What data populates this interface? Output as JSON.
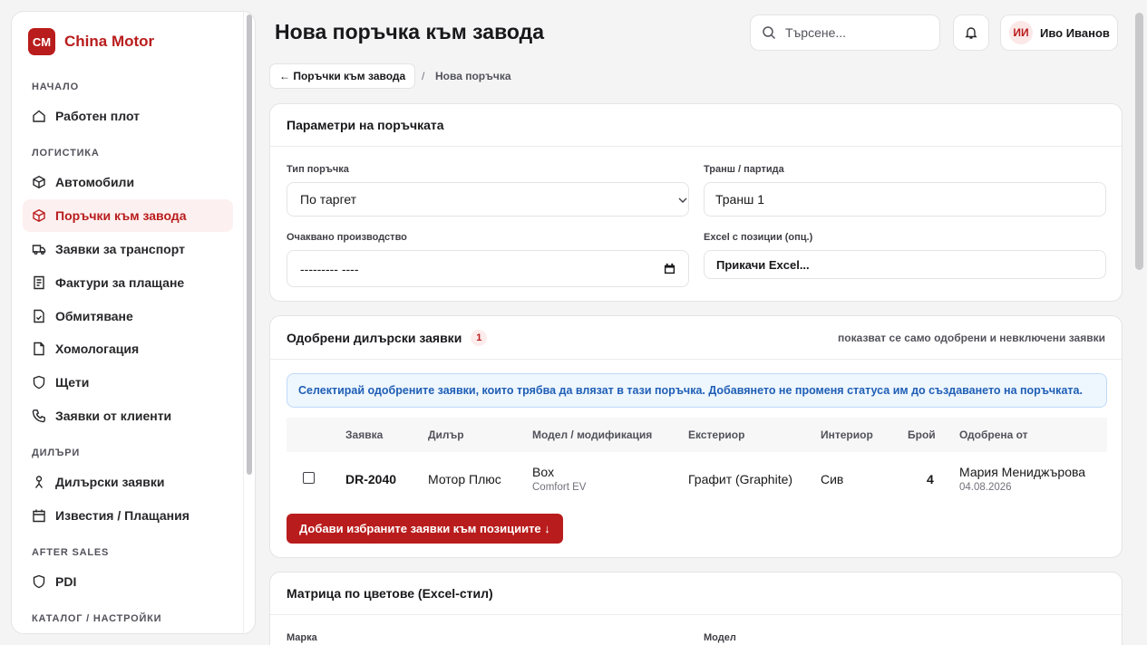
{
  "app": {
    "logo_text": "CM",
    "name": "China Motor"
  },
  "sidebar": {
    "sections": [
      {
        "title": "НАЧАЛО"
      },
      {
        "title": "ЛОГИСТИКА"
      },
      {
        "title": "ДИЛЪРИ"
      },
      {
        "title": "AFTER SALES"
      },
      {
        "title": "КАТАЛОГ / НАСТРОЙКИ"
      }
    ],
    "items": [
      {
        "label": "Работен плот",
        "icon": "home-icon"
      },
      {
        "label": "Автомобили",
        "icon": "box-icon"
      },
      {
        "label": "Поръчки към завода",
        "icon": "box-icon",
        "active": true
      },
      {
        "label": "Заявки за транспорт",
        "icon": "truck-icon"
      },
      {
        "label": "Фактури за плащане",
        "icon": "invoice-icon"
      },
      {
        "label": "Обмитяване",
        "icon": "document-check-icon"
      },
      {
        "label": "Хомологация",
        "icon": "file-icon"
      },
      {
        "label": "Щети",
        "icon": "shield-icon"
      },
      {
        "label": "Заявки от клиенти",
        "icon": "phone-icon"
      },
      {
        "label": "Дилърски заявки",
        "icon": "person-icon"
      },
      {
        "label": "Известия / Плащания",
        "icon": "calendar-icon"
      },
      {
        "label": "PDI",
        "icon": "shield-icon"
      }
    ]
  },
  "header": {
    "title": "Нова поръчка към завода",
    "search_placeholder": "Търсене...",
    "user_initials": "ИИ",
    "user_name": "Иво Иванов"
  },
  "breadcrumb": {
    "back_label": "← Поръчки към завода",
    "separator": "/",
    "current": "Нова поръчка"
  },
  "params": {
    "title": "Параметри на поръчката",
    "order_type_label": "Тип поръчка",
    "order_type_value": "По таргет",
    "batch_label": "Транш / партида",
    "batch_value": "Транш 1",
    "production_label": "Очаквано производство",
    "production_value": "--------- ----",
    "excel_label": "Excel с позиции (опц.)",
    "excel_button": "Прикачи Excel..."
  },
  "approved": {
    "title": "Одобрени дилърски заявки",
    "count": "1",
    "note": "показват се само одобрени и невключени заявки",
    "info": "Селектирай одобрените заявки, които трябва да влязат в тази поръчка. Добавянето не променя статуса им до създаването на поръчката.",
    "columns": [
      "Заявка",
      "Дилър",
      "Модел / модификация",
      "Екстериор",
      "Интериор",
      "Брой",
      "Одобрена от"
    ],
    "rows": [
      {
        "request": "DR-2040",
        "dealer": "Мотор Плюс",
        "model": "Box",
        "modification": "Comfort EV",
        "exterior": "Графит (Graphite)",
        "interior": "Сив",
        "qty": "4",
        "approved_by": "Мария Мениджърова",
        "approved_date": "04.08.2026"
      }
    ],
    "add_button": "Добави избраните заявки към позициите ↓"
  },
  "matrix": {
    "title": "Матрица по цветове (Excel-стил)",
    "brand_label": "Марка",
    "model_label": "Модел"
  },
  "colors": {
    "accent": "#b91c1c",
    "info": "#1f5fb5"
  }
}
